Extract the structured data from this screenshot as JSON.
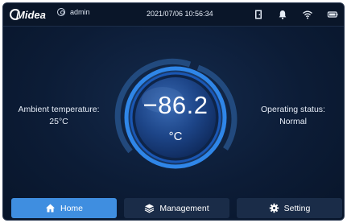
{
  "statusbar": {
    "brand": "Midea",
    "user": "admin",
    "datetime": "2021/07/06  10:56:34",
    "icons": [
      "door-icon",
      "bell-icon",
      "wifi-icon",
      "battery-icon"
    ]
  },
  "main": {
    "ambient_label": "Ambient temperature:",
    "ambient_value": "25°C",
    "operating_label": "Operating status:",
    "operating_value": "Normal",
    "temperature": "−86.2",
    "temperature_unit": "°C"
  },
  "nav": {
    "home": "Home",
    "management": "Management",
    "setting": "Setting",
    "active": "home"
  },
  "colors": {
    "accent": "#3f8ee0",
    "background": "#0c1c36",
    "button": "#1a2c48"
  }
}
